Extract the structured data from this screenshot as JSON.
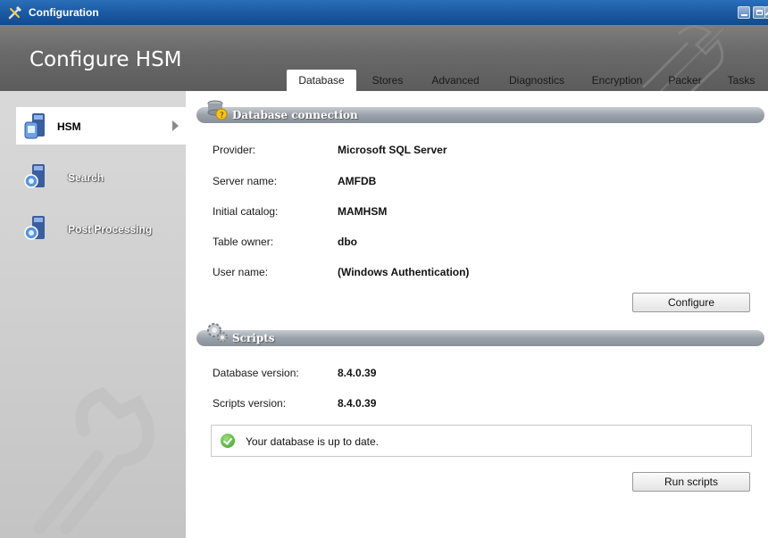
{
  "window": {
    "title": "Configuration",
    "icon": "tools-icon"
  },
  "header": {
    "title": "Configure HSM"
  },
  "tabs": [
    {
      "label": "Database",
      "active": true
    },
    {
      "label": "Stores",
      "active": false
    },
    {
      "label": "Advanced",
      "active": false
    },
    {
      "label": "Diagnostics",
      "active": false
    },
    {
      "label": "Encryption",
      "active": false
    },
    {
      "label": "Packer",
      "active": false
    },
    {
      "label": "Tasks",
      "active": false
    }
  ],
  "sidebar": {
    "items": [
      {
        "label": "HSM",
        "icon": "database-server-icon",
        "active": true
      },
      {
        "label": "Search",
        "icon": "search-server-icon",
        "active": false
      },
      {
        "label": "Post Processing",
        "icon": "search-server-icon",
        "active": false
      }
    ]
  },
  "database_connection": {
    "title": "Database connection",
    "rows": [
      {
        "label": "Provider:",
        "value": "Microsoft SQL Server"
      },
      {
        "label": "Server name:",
        "value": "AMFDB"
      },
      {
        "label": "Initial catalog:",
        "value": "MAMHSM"
      },
      {
        "label": "Table owner:",
        "value": "dbo"
      },
      {
        "label": "User name:",
        "value": "(Windows Authentication)"
      }
    ],
    "configure_label": "Configure"
  },
  "scripts": {
    "title": "Scripts",
    "rows": [
      {
        "label": "Database version:",
        "value": "8.4.0.39"
      },
      {
        "label": "Scripts version:",
        "value": "8.4.0.39"
      }
    ],
    "status_text": "Your database is up to date.",
    "run_label": "Run scripts"
  },
  "colors": {
    "titlebar": "#1b5aa3",
    "header": "#6a6a6a",
    "sidebar": "#cfcfcf",
    "section_bar": "#9aa1aa",
    "status_ok": "#3f9a27"
  }
}
